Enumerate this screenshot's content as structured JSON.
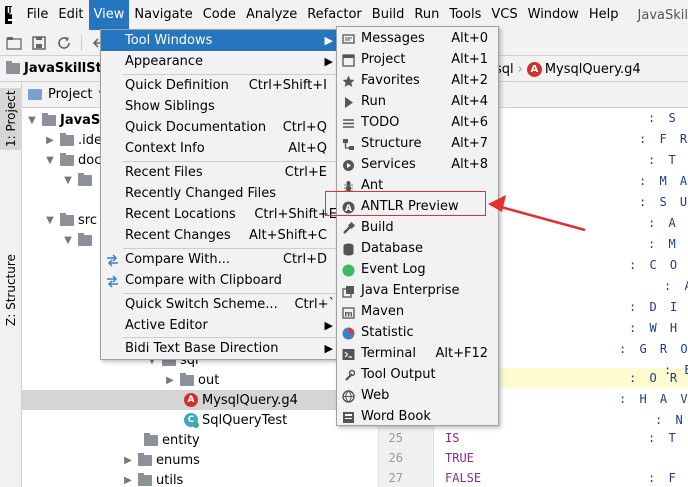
{
  "menubar": {
    "items": [
      {
        "label": "File"
      },
      {
        "label": "Edit"
      },
      {
        "label": "View"
      },
      {
        "label": "Navigate"
      },
      {
        "label": "Code"
      },
      {
        "label": "Analyze"
      },
      {
        "label": "Refactor"
      },
      {
        "label": "Build"
      },
      {
        "label": "Run"
      },
      {
        "label": "Tools"
      },
      {
        "label": "VCS"
      },
      {
        "label": "Window"
      },
      {
        "label": "Help"
      }
    ],
    "title": "JavaSkil"
  },
  "navbar": {
    "project": "JavaSkillSta",
    "crumb_folder": "sql",
    "crumb_file": "MysqlQuery.g4"
  },
  "stripe": {
    "project": "1: Project",
    "structure": "Z: Structure"
  },
  "project_panel": {
    "header": "Project",
    "rows": [
      {
        "label": "JavaSk"
      },
      {
        "label": ".ide"
      },
      {
        "label": "doc"
      },
      {
        "label": ""
      },
      {
        "label": "src"
      },
      {
        "label": ""
      },
      {
        "label": "sql"
      },
      {
        "label": "out"
      },
      {
        "label": "MysqlQuery.g4"
      },
      {
        "label": "SqlQueryTest"
      },
      {
        "label": "entity"
      },
      {
        "label": "enums"
      },
      {
        "label": "utils"
      }
    ]
  },
  "editor": {
    "line_numbers": [
      "25",
      "26",
      "27"
    ],
    "code_lines": [
      "IS",
      "TRUE",
      "FALSE"
    ],
    "tokens": [
      ": S E",
      ": F R O",
      ": T A",
      ": M A X",
      ": S U M",
      ": A V",
      ": M I",
      ": C O U N",
      ": A",
      ": D I S T",
      ": W H E R",
      ": G R O U",
      ": B",
      ": O R D E",
      ": H A V I",
      ": N O",
      ": T R",
      ": F A"
    ]
  },
  "view_menu": {
    "items": [
      {
        "label": "Tool Windows",
        "shortcut": ""
      },
      {
        "label": "Appearance",
        "shortcut": ""
      },
      {
        "label": "Quick Definition",
        "shortcut": "Ctrl+Shift+I"
      },
      {
        "label": "Show Siblings",
        "shortcut": ""
      },
      {
        "label": "Quick Documentation",
        "shortcut": "Ctrl+Q"
      },
      {
        "label": "Context Info",
        "shortcut": "Alt+Q"
      },
      {
        "label": "Recent Files",
        "shortcut": "Ctrl+E"
      },
      {
        "label": "Recently Changed Files",
        "shortcut": ""
      },
      {
        "label": "Recent Locations",
        "shortcut": "Ctrl+Shift+E"
      },
      {
        "label": "Recent Changes",
        "shortcut": "Alt+Shift+C"
      },
      {
        "label": "Compare With...",
        "shortcut": "Ctrl+D"
      },
      {
        "label": "Compare with Clipboard",
        "shortcut": ""
      },
      {
        "label": "Quick Switch Scheme...",
        "shortcut": "Ctrl+`"
      },
      {
        "label": "Active Editor",
        "shortcut": ""
      },
      {
        "label": "Bidi Text Base Direction",
        "shortcut": ""
      }
    ]
  },
  "tool_windows_menu": {
    "items": [
      {
        "label": "Messages",
        "shortcut": "Alt+0",
        "icon": "messages-icon"
      },
      {
        "label": "Project",
        "shortcut": "Alt+1",
        "icon": "project-icon"
      },
      {
        "label": "Favorites",
        "shortcut": "Alt+2",
        "icon": "star-icon"
      },
      {
        "label": "Run",
        "shortcut": "Alt+4",
        "icon": "run-icon"
      },
      {
        "label": "TODO",
        "shortcut": "Alt+6",
        "icon": "todo-icon"
      },
      {
        "label": "Structure",
        "shortcut": "Alt+7",
        "icon": "structure-icon"
      },
      {
        "label": "Services",
        "shortcut": "Alt+8",
        "icon": "services-icon"
      },
      {
        "label": "Ant",
        "shortcut": "",
        "icon": "ant-icon"
      },
      {
        "label": "ANTLR Preview",
        "shortcut": "",
        "icon": "antlr-icon"
      },
      {
        "label": "Build",
        "shortcut": "",
        "icon": "build-icon"
      },
      {
        "label": "Database",
        "shortcut": "",
        "icon": "database-icon"
      },
      {
        "label": "Event Log",
        "shortcut": "",
        "icon": "event-log-icon"
      },
      {
        "label": "Java Enterprise",
        "shortcut": "",
        "icon": "java-enterprise-icon"
      },
      {
        "label": "Maven",
        "shortcut": "",
        "icon": "maven-icon"
      },
      {
        "label": "Statistic",
        "shortcut": "",
        "icon": "statistic-icon"
      },
      {
        "label": "Terminal",
        "shortcut": "Alt+F12",
        "icon": "terminal-icon"
      },
      {
        "label": "Tool Output",
        "shortcut": "",
        "icon": "tool-output-icon"
      },
      {
        "label": "Web",
        "shortcut": "",
        "icon": "web-icon"
      },
      {
        "label": "Word Book",
        "shortcut": "",
        "icon": "word-book-icon"
      }
    ]
  },
  "colors": {
    "menu_highlight": "#2675bf",
    "annotation": "#e03030",
    "keyword": "#8b2c8b",
    "token": "#1d3c88"
  }
}
